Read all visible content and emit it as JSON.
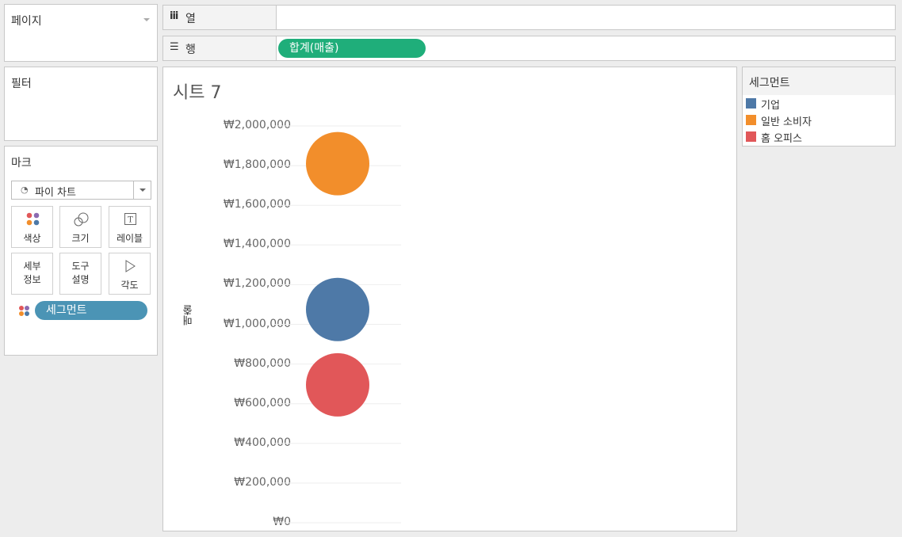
{
  "pages_panel": {
    "title": "페이지"
  },
  "columns_shelf": {
    "icon": "iii",
    "label": "열"
  },
  "rows_shelf": {
    "icon": "☰",
    "label": "행",
    "pill": "합계(매출)",
    "pill_color": "#1fae7a"
  },
  "filters_panel": {
    "title": "필터"
  },
  "marks_panel": {
    "title": "마크",
    "mark_type": "파이 차트",
    "buttons": {
      "color": "색상",
      "size": "크기",
      "label": "레이블",
      "detail": "세부\n정보",
      "tooltip": "도구\n설명",
      "angle": "각도"
    },
    "field_pill": "세그먼트",
    "field_pill_color": "#4b94b5"
  },
  "view": {
    "title": "시트 7",
    "y_label": "매출"
  },
  "legend": {
    "title": "세그먼트",
    "items": [
      {
        "label": "기업",
        "color": "#4e79a7"
      },
      {
        "label": "일반 소비자",
        "color": "#f28e2b"
      },
      {
        "label": "홈 오피스",
        "color": "#e15759"
      }
    ]
  },
  "chart_data": {
    "type": "scatter",
    "ylabel": "매출",
    "ylim": [
      0,
      2000000
    ],
    "yticks": [
      "₩2,000,000",
      "₩1,800,000",
      "₩1,600,000",
      "₩1,400,000",
      "₩1,200,000",
      "₩1,000,000",
      "₩800,000",
      "₩600,000",
      "₩400,000",
      "₩200,000",
      "₩0"
    ],
    "series": [
      {
        "name": "일반 소비자",
        "value": 1810000,
        "color": "#f28e2b"
      },
      {
        "name": "기업",
        "value": 1075000,
        "color": "#4e79a7"
      },
      {
        "name": "홈 오피스",
        "value": 695000,
        "color": "#e15759"
      }
    ],
    "grid": true
  }
}
